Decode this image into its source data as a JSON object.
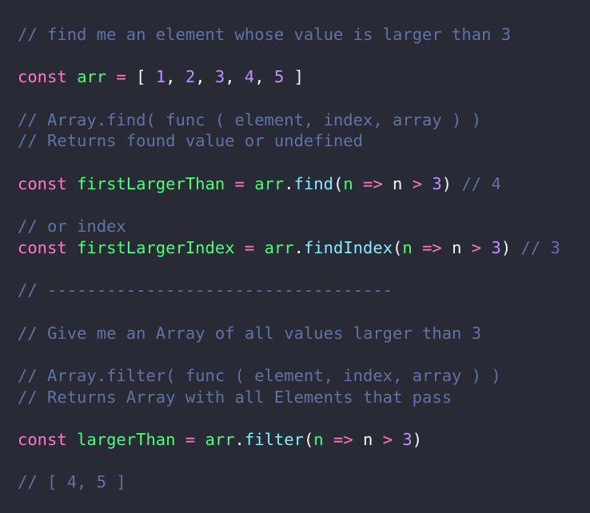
{
  "colors": {
    "background": "#282a36",
    "comment": "#6272a4",
    "keyword": "#ff79c6",
    "variable": "#50fa7b",
    "operator": "#ff79c6",
    "number": "#bd93f9",
    "property": "#8be9fd",
    "punctuation": "#f8f8f2",
    "parameter": "#50fa7b",
    "text": "#f8f8f2"
  },
  "lines": [
    [
      {
        "t": "comment",
        "v": "// find me an element whose value is larger than 3"
      }
    ],
    [],
    [
      {
        "t": "keyword",
        "v": "const"
      },
      {
        "t": "text",
        "v": " "
      },
      {
        "t": "variable",
        "v": "arr"
      },
      {
        "t": "text",
        "v": " "
      },
      {
        "t": "operator",
        "v": "="
      },
      {
        "t": "text",
        "v": " "
      },
      {
        "t": "punct",
        "v": "["
      },
      {
        "t": "text",
        "v": " "
      },
      {
        "t": "number",
        "v": "1"
      },
      {
        "t": "punct",
        "v": ","
      },
      {
        "t": "text",
        "v": " "
      },
      {
        "t": "number",
        "v": "2"
      },
      {
        "t": "punct",
        "v": ","
      },
      {
        "t": "text",
        "v": " "
      },
      {
        "t": "number",
        "v": "3"
      },
      {
        "t": "punct",
        "v": ","
      },
      {
        "t": "text",
        "v": " "
      },
      {
        "t": "number",
        "v": "4"
      },
      {
        "t": "punct",
        "v": ","
      },
      {
        "t": "text",
        "v": " "
      },
      {
        "t": "number",
        "v": "5"
      },
      {
        "t": "text",
        "v": " "
      },
      {
        "t": "punct",
        "v": "]"
      }
    ],
    [],
    [
      {
        "t": "comment",
        "v": "// Array.find( func ( element, index, array ) )"
      }
    ],
    [
      {
        "t": "comment",
        "v": "// Returns found value or undefined"
      }
    ],
    [],
    [
      {
        "t": "keyword",
        "v": "const"
      },
      {
        "t": "text",
        "v": " "
      },
      {
        "t": "variable",
        "v": "firstLargerThan"
      },
      {
        "t": "text",
        "v": " "
      },
      {
        "t": "operator",
        "v": "="
      },
      {
        "t": "text",
        "v": " "
      },
      {
        "t": "variable",
        "v": "arr"
      },
      {
        "t": "punct",
        "v": "."
      },
      {
        "t": "property",
        "v": "find"
      },
      {
        "t": "punct",
        "v": "("
      },
      {
        "t": "param",
        "v": "n"
      },
      {
        "t": "text",
        "v": " "
      },
      {
        "t": "operator",
        "v": "=>"
      },
      {
        "t": "text",
        "v": " "
      },
      {
        "t": "text",
        "v": "n"
      },
      {
        "t": "text",
        "v": " "
      },
      {
        "t": "operator",
        "v": ">"
      },
      {
        "t": "text",
        "v": " "
      },
      {
        "t": "number",
        "v": "3"
      },
      {
        "t": "punct",
        "v": ")"
      },
      {
        "t": "text",
        "v": " "
      },
      {
        "t": "comment",
        "v": "// 4"
      }
    ],
    [],
    [
      {
        "t": "comment",
        "v": "// or index"
      }
    ],
    [
      {
        "t": "keyword",
        "v": "const"
      },
      {
        "t": "text",
        "v": " "
      },
      {
        "t": "variable",
        "v": "firstLargerIndex"
      },
      {
        "t": "text",
        "v": " "
      },
      {
        "t": "operator",
        "v": "="
      },
      {
        "t": "text",
        "v": " "
      },
      {
        "t": "variable",
        "v": "arr"
      },
      {
        "t": "punct",
        "v": "."
      },
      {
        "t": "property",
        "v": "findIndex"
      },
      {
        "t": "punct",
        "v": "("
      },
      {
        "t": "param",
        "v": "n"
      },
      {
        "t": "text",
        "v": " "
      },
      {
        "t": "operator",
        "v": "=>"
      },
      {
        "t": "text",
        "v": " "
      },
      {
        "t": "text",
        "v": "n"
      },
      {
        "t": "text",
        "v": " "
      },
      {
        "t": "operator",
        "v": ">"
      },
      {
        "t": "text",
        "v": " "
      },
      {
        "t": "number",
        "v": "3"
      },
      {
        "t": "punct",
        "v": ")"
      },
      {
        "t": "text",
        "v": " "
      },
      {
        "t": "comment",
        "v": "// 3"
      }
    ],
    [],
    [
      {
        "t": "comment",
        "v": "// -----------------------------------"
      }
    ],
    [],
    [
      {
        "t": "comment",
        "v": "// Give me an Array of all values larger than 3"
      }
    ],
    [],
    [
      {
        "t": "comment",
        "v": "// Array.filter( func ( element, index, array ) )"
      }
    ],
    [
      {
        "t": "comment",
        "v": "// Returns Array with all Elements that pass"
      }
    ],
    [],
    [
      {
        "t": "keyword",
        "v": "const"
      },
      {
        "t": "text",
        "v": " "
      },
      {
        "t": "variable",
        "v": "largerThan"
      },
      {
        "t": "text",
        "v": " "
      },
      {
        "t": "operator",
        "v": "="
      },
      {
        "t": "text",
        "v": " "
      },
      {
        "t": "variable",
        "v": "arr"
      },
      {
        "t": "punct",
        "v": "."
      },
      {
        "t": "property",
        "v": "filter"
      },
      {
        "t": "punct",
        "v": "("
      },
      {
        "t": "param",
        "v": "n"
      },
      {
        "t": "text",
        "v": " "
      },
      {
        "t": "operator",
        "v": "=>"
      },
      {
        "t": "text",
        "v": " "
      },
      {
        "t": "text",
        "v": "n"
      },
      {
        "t": "text",
        "v": " "
      },
      {
        "t": "operator",
        "v": ">"
      },
      {
        "t": "text",
        "v": " "
      },
      {
        "t": "number",
        "v": "3"
      },
      {
        "t": "punct",
        "v": ")"
      }
    ],
    [],
    [
      {
        "t": "comment",
        "v": "// [ 4, 5 ]"
      }
    ]
  ]
}
